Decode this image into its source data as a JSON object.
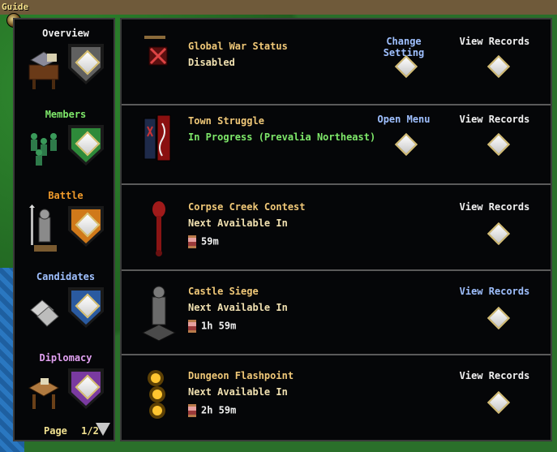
{
  "guide": {
    "label": "Guide"
  },
  "sidebar": {
    "categories": [
      {
        "label": "Overview",
        "color": "#f0f0f0",
        "shield": "#606060",
        "selected": false
      },
      {
        "label": "Members",
        "color": "#7ee86a",
        "shield": "#2e8a3a",
        "selected": false
      },
      {
        "label": "Battle",
        "color": "#f09a2a",
        "shield": "#d0791a",
        "selected": true
      },
      {
        "label": "Candidates",
        "color": "#9fc0ff",
        "shield": "#2a5aa0",
        "selected": false
      },
      {
        "label": "Diplomacy",
        "color": "#e0a0f0",
        "shield": "#7a3aa0",
        "selected": false
      }
    ],
    "pager": {
      "label": "Page",
      "value": "1/2"
    }
  },
  "rows": [
    {
      "title": "Global War Status",
      "status": "Disabled",
      "status_color": "normal",
      "actions": [
        {
          "label": "Change Setting",
          "style": "blue"
        },
        {
          "label": "View Records",
          "style": "white"
        }
      ],
      "timer": ""
    },
    {
      "title": "Town Struggle",
      "status": "In Progress (Prevalia Northeast)",
      "status_color": "green",
      "actions": [
        {
          "label": "Open Menu",
          "style": "blue"
        },
        {
          "label": "View Records",
          "style": "white"
        }
      ],
      "timer": ""
    },
    {
      "title": "Corpse Creek Contest",
      "status": "Next Available In",
      "status_color": "normal",
      "actions": [
        {
          "label": "View Records",
          "style": "white"
        }
      ],
      "timer": "59m"
    },
    {
      "title": "Castle Siege",
      "status": "Next Available In",
      "status_color": "normal",
      "actions": [
        {
          "label": "View Records",
          "style": "blue"
        }
      ],
      "timer": "1h 59m"
    },
    {
      "title": "Dungeon Flashpoint",
      "status": "Next Available In",
      "status_color": "normal",
      "actions": [
        {
          "label": "View Records",
          "style": "white"
        }
      ],
      "timer": "2h 59m"
    }
  ]
}
